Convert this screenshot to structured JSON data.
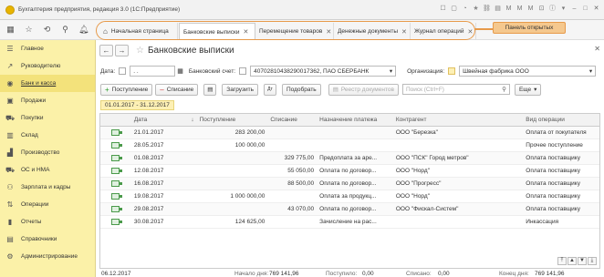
{
  "app": {
    "title": "Бухгалтерия предприятия, редакция 3.0  (1С:Предприятие)"
  },
  "tabs": [
    {
      "label": "Начальная страница"
    },
    {
      "label": "Банковские выписки"
    },
    {
      "label": "Перемещение товаров"
    },
    {
      "label": "Денежные документы"
    },
    {
      "label": "Журнал операций"
    }
  ],
  "callout": {
    "label": "Панель открытых"
  },
  "sidebar": {
    "items": [
      {
        "label": "Главное",
        "icon": "menu-icon"
      },
      {
        "label": "Руководителю",
        "icon": "chart-icon"
      },
      {
        "label": "Банк и касса",
        "icon": "bank-icon"
      },
      {
        "label": "Продажи",
        "icon": "cart-icon"
      },
      {
        "label": "Покупки",
        "icon": "basket-icon"
      },
      {
        "label": "Склад",
        "icon": "warehouse-icon"
      },
      {
        "label": "Производство",
        "icon": "factory-icon"
      },
      {
        "label": "ОС и НМА",
        "icon": "truck-icon"
      },
      {
        "label": "Зарплата и кадры",
        "icon": "people-icon"
      },
      {
        "label": "Операции",
        "icon": "operations-icon"
      },
      {
        "label": "Отчеты",
        "icon": "report-icon"
      },
      {
        "label": "Справочники",
        "icon": "book-icon"
      },
      {
        "label": "Администрирование",
        "icon": "gear-icon"
      }
    ]
  },
  "main": {
    "title": "Банковские выписки",
    "filters": {
      "date_label": "Дата:",
      "date_value": ". .",
      "account_label": "Банковский счет:",
      "account_value": "40702810438290017362, ПАО СБЕРБАНК",
      "org_label": "Организация:",
      "org_value": "Швейная фабрика ООО"
    },
    "toolbar": {
      "receipt": "Поступление",
      "writeoff": "Списание",
      "load": "Загрузить",
      "pick": "Подобрать",
      "registry": "Реестр документов",
      "search_placeholder": "Поиск (Ctrl+F)",
      "more": "Еще"
    },
    "period": "01.01.2017 - 31.12.2017",
    "columns": [
      "Дата",
      "Поступление",
      "Списание",
      "Назначение платежа",
      "Контрагент",
      "Вид операции"
    ],
    "rows": [
      {
        "date": "21.01.2017",
        "in": "283 200,00",
        "out": "",
        "purpose": "",
        "counterparty": "ООО \"Березка\"",
        "op": "Оплата от покупателя"
      },
      {
        "date": "28.05.2017",
        "in": "100 000,00",
        "out": "",
        "purpose": "",
        "counterparty": "",
        "op": "Прочее поступление"
      },
      {
        "date": "01.08.2017",
        "in": "",
        "out": "329 775,00",
        "purpose": "Предоплата за аре...",
        "counterparty": "ООО \"ПСК\" Город метров\"",
        "op": "Оплата поставщику"
      },
      {
        "date": "12.08.2017",
        "in": "",
        "out": "55 050,00",
        "purpose": "Оплата по договор...",
        "counterparty": "ООО \"Норд\"",
        "op": "Оплата поставщику"
      },
      {
        "date": "16.08.2017",
        "in": "",
        "out": "88 500,00",
        "purpose": "Оплата по договор...",
        "counterparty": "ООО \"Прогресс\"",
        "op": "Оплата поставщику"
      },
      {
        "date": "19.08.2017",
        "in": "1 000 000,00",
        "out": "",
        "purpose": "Оплата за продукц...",
        "counterparty": "ООО \"Норд\"",
        "op": "Оплата поставщику"
      },
      {
        "date": "29.08.2017",
        "in": "",
        "out": "43 070,00",
        "purpose": "Оплата по договор...",
        "counterparty": "ООО \"Фискал-Систем\"",
        "op": "Оплата поставщику"
      },
      {
        "date": "30.08.2017",
        "in": "124 625,00",
        "out": "",
        "purpose": "Зачисление на рас...",
        "counterparty": "",
        "op": "Инкассация"
      }
    ],
    "footer": {
      "date": "06.12.2017",
      "start_label": "Начало дня:",
      "start_value": "769 141,96",
      "in_label": "Поступило:",
      "in_value": "0,00",
      "out_label": "Списано:",
      "out_value": "0,00",
      "end_label": "Конец дня:",
      "end_value": "769 141,96"
    }
  }
}
